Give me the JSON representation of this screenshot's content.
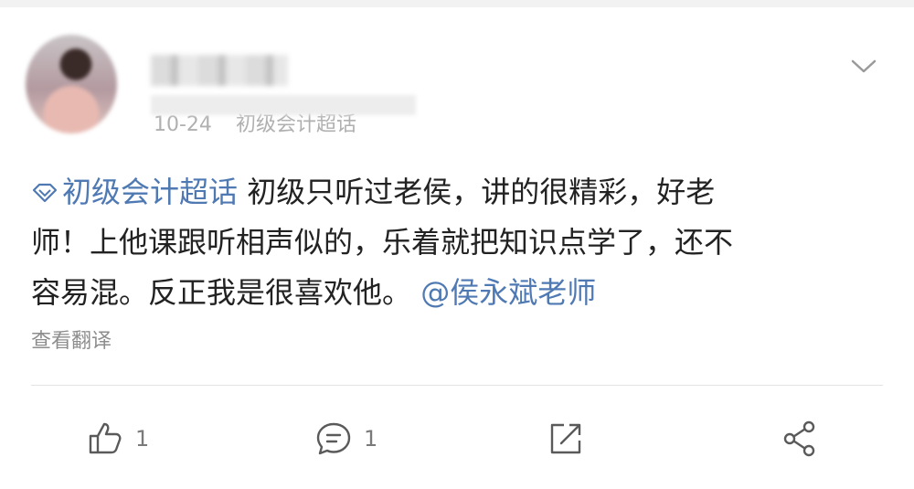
{
  "post": {
    "meta": {
      "time": "10-24",
      "source": "初级会计超话"
    },
    "content": {
      "topic": "初级会计超话",
      "line1": "初级只听过老侯，讲的很精彩，好老",
      "line2": "师！上他课跟听相声似的，乐着就把知识点学了，还不",
      "line3": "容易混。反正我是很喜欢他。",
      "mention": "@侯永斌老师"
    },
    "translate_label": "查看翻译",
    "actions": {
      "like_count": "1",
      "comment_count": "1"
    }
  },
  "icons": {
    "more": "chevron-down-icon",
    "topic": "diamond-icon",
    "like": "thumbs-up-icon",
    "comment": "comment-icon",
    "repost": "repost-icon",
    "share": "share-icon"
  },
  "colors": {
    "link": "#4f79b3",
    "muted": "#8d8d8d",
    "background": "#f2f2f2"
  }
}
